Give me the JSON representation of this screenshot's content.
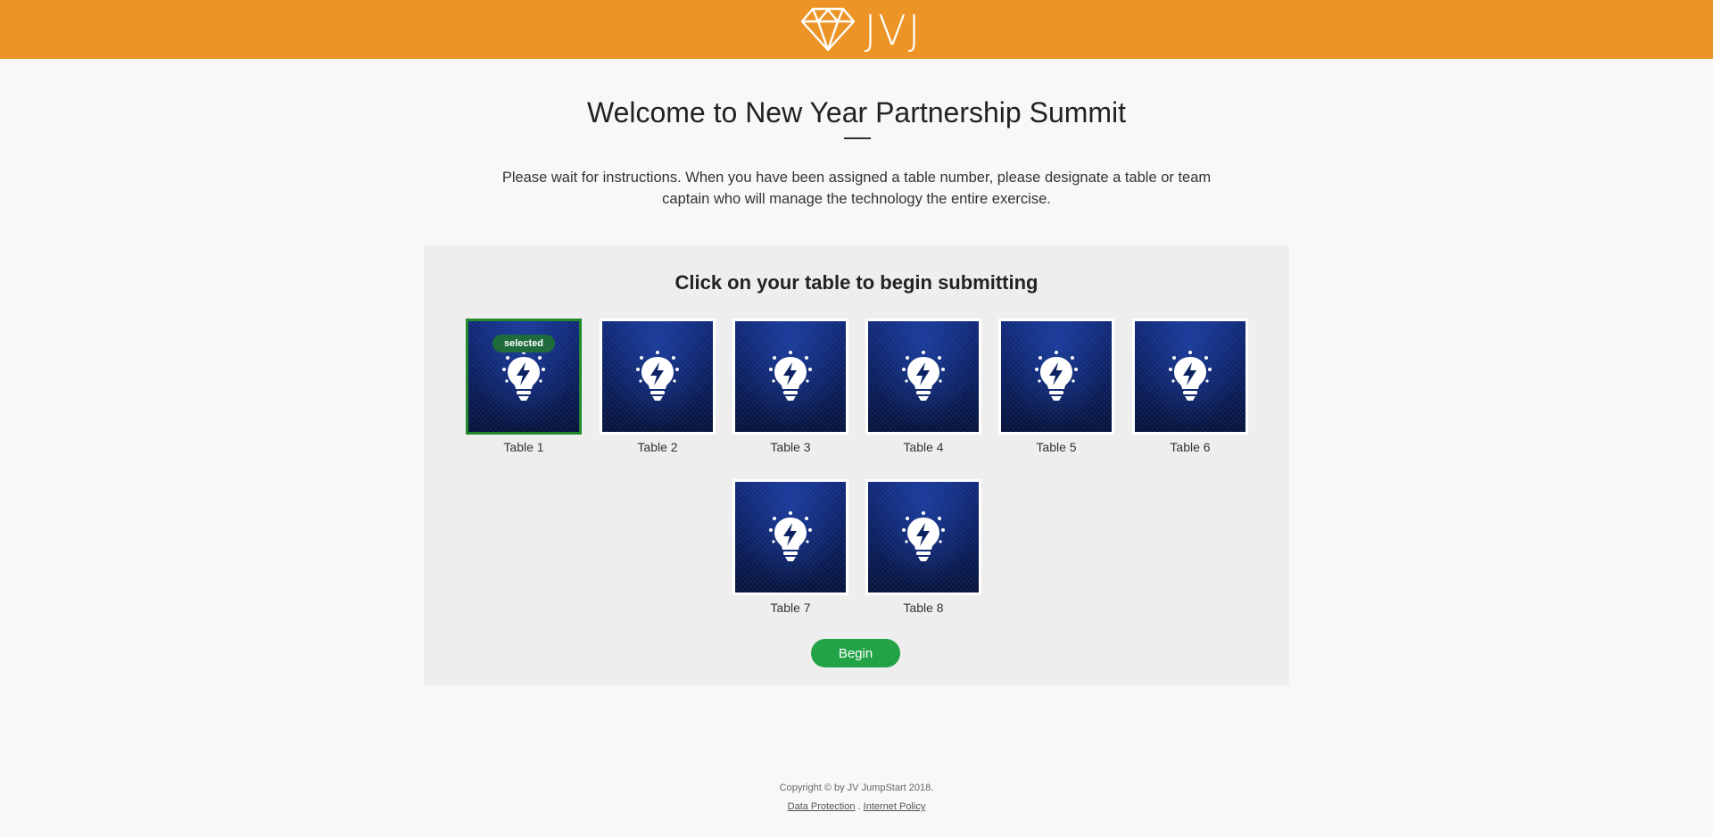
{
  "header": {
    "logo_text": "JVJ",
    "logo_icon": "diamond-icon",
    "background": "#ec9426"
  },
  "main": {
    "title": "Welcome to New Year Partnership Summit",
    "intro": "Please wait for instructions. When you have been assigned a table number, please designate a table or team captain who will manage the technology the entire exercise."
  },
  "panel": {
    "title": "Click on your table to begin submitting",
    "selected_badge": "selected",
    "tile_icon": "lightbulb-bolt-icon",
    "tables": [
      {
        "label": "Table 1",
        "selected": true
      },
      {
        "label": "Table 2",
        "selected": false
      },
      {
        "label": "Table 3",
        "selected": false
      },
      {
        "label": "Table 4",
        "selected": false
      },
      {
        "label": "Table 5",
        "selected": false
      },
      {
        "label": "Table 6",
        "selected": false
      },
      {
        "label": "Table 7",
        "selected": false
      },
      {
        "label": "Table 8",
        "selected": false
      }
    ],
    "begin_label": "Begin",
    "accent": "#23a347"
  },
  "footer": {
    "copyright": "Copyright © by JV JumpStart 2018.",
    "links": [
      "Data Protection",
      "Internet Policy"
    ],
    "separator": "."
  }
}
